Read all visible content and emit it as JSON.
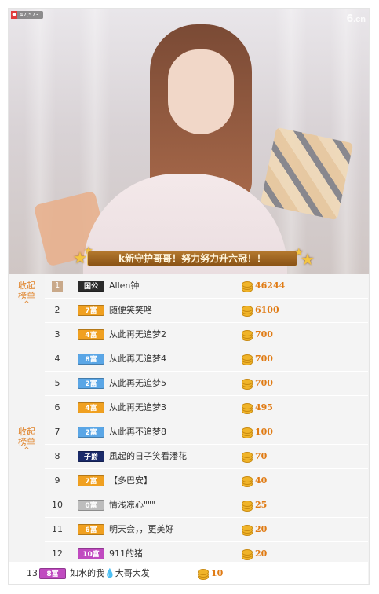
{
  "video": {
    "view_count": "47,573",
    "logo_main": "6",
    "logo_suffix": ".cn",
    "banner_text": "k新守护哥哥！努力努力升六冠！！"
  },
  "sections": [
    {
      "collapse_label_line1": "收起",
      "collapse_label_line2": "榜单",
      "chevron": "^"
    },
    {
      "collapse_label_line1": "收起",
      "collapse_label_line2": "榜单",
      "chevron": "^"
    }
  ],
  "colors": {
    "badge_guo": "#2b2b2b",
    "badge_fu": "#f0a020",
    "badge_blue": "#5aa6e6",
    "badge_zi": "#1a2a6a",
    "badge_gray": "#bdbdbd",
    "badge_purple": "#c04ac0",
    "score": "#e07b14",
    "accent": "#e0842b"
  },
  "rows": [
    {
      "rank": "1",
      "badge_text": "国公",
      "badge_color": "#2b2b2b",
      "name": "Allen钟",
      "score": "46244"
    },
    {
      "rank": "2",
      "badge_text": "7富",
      "badge_color": "#f0a020",
      "name": "随便笑笑咯",
      "score": "6100"
    },
    {
      "rank": "3",
      "badge_text": "4富",
      "badge_color": "#f0a020",
      "name": "从此再无追梦2",
      "score": "700"
    },
    {
      "rank": "4",
      "badge_text": "8富",
      "badge_color": "#5aa6e6",
      "name": "从此再无追梦4",
      "score": "700"
    },
    {
      "rank": "5",
      "badge_text": "2富",
      "badge_color": "#5aa6e6",
      "name": "从此再无追梦5",
      "score": "700"
    },
    {
      "rank": "6",
      "badge_text": "4富",
      "badge_color": "#f0a020",
      "name": "从此再无追梦3",
      "score": "495"
    },
    {
      "rank": "7",
      "badge_text": "2富",
      "badge_color": "#5aa6e6",
      "name": "从此再不追梦8",
      "score": "100"
    },
    {
      "rank": "8",
      "badge_text": "子爵",
      "badge_color": "#1a2a6a",
      "name": "風起的日子笑看潘花",
      "score": "70"
    },
    {
      "rank": "9",
      "badge_text": "7富",
      "badge_color": "#f0a020",
      "name": "【多巴安】",
      "score": "40"
    },
    {
      "rank": "10",
      "badge_text": "0富",
      "badge_color": "#bdbdbd",
      "name": "情浅凉心\"\"\"",
      "score": "25"
    },
    {
      "rank": "11",
      "badge_text": "6富",
      "badge_color": "#f0a020",
      "name": "明天会，，更美好",
      "score": "20"
    },
    {
      "rank": "12",
      "badge_text": "10富",
      "badge_color": "#c04ac0",
      "name": "911的猪",
      "score": "20"
    },
    {
      "rank": "13",
      "badge_text": "8富",
      "badge_color": "#c04ac0",
      "name": "如水的我💧大哥大发",
      "score": "10"
    }
  ]
}
